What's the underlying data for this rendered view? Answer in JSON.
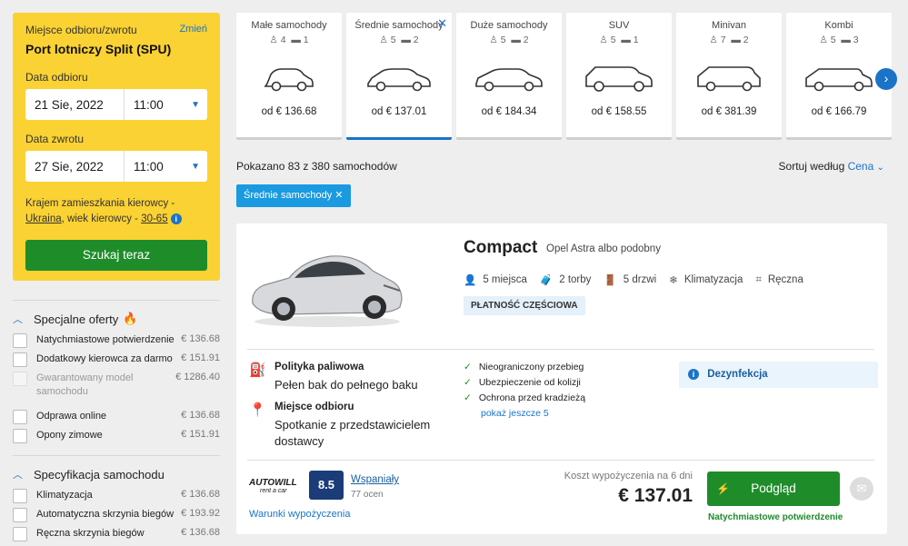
{
  "search": {
    "location_label": "Miejsce odbioru/zwrotu",
    "change_link": "Zmień",
    "location": "Port lotniczy Split (SPU)",
    "pickup_label": "Data odbioru",
    "pickup_date": "21  Sie, 2022",
    "pickup_time": "11:00",
    "return_label": "Data zwrotu",
    "return_date": "27  Sie, 2022",
    "return_time": "11:00",
    "residence_prefix": "Krajem zamieszkania kierowcy -",
    "residence_country": "Ukraina",
    "age_prefix": ", wiek kierowcy - ",
    "age_range": "30-65",
    "search_button": "Szukaj teraz"
  },
  "filters": {
    "special_title": "Specjalne oferty",
    "special_items": [
      {
        "label": "Natychmiastowe potwierdzenie",
        "price": "€ 136.68"
      },
      {
        "label": "Dodatkowy kierowca za darmo",
        "price": "€ 151.91"
      },
      {
        "label": "Gwarantowany model samochodu",
        "price": "€ 1286.40"
      },
      {
        "label": "Odprawa online",
        "price": "€ 136.68"
      },
      {
        "label": "Opony zimowe",
        "price": "€ 151.91"
      }
    ],
    "spec_title": "Specyfikacja samochodu",
    "spec_items": [
      {
        "label": "Klimatyzacja",
        "price": "€ 136.68"
      },
      {
        "label": "Automatyczna skrzynia biegów",
        "price": "€ 193.92"
      },
      {
        "label": "Ręczna skrzynia biegów",
        "price": "€ 136.68"
      }
    ]
  },
  "categories": [
    {
      "name": "Małe samochody",
      "seats": "4",
      "bags": "1",
      "price": "od € 136.68"
    },
    {
      "name": "Średnie samochody",
      "seats": "5",
      "bags": "2",
      "price": "od € 137.01"
    },
    {
      "name": "Duże samochody",
      "seats": "5",
      "bags": "2",
      "price": "od € 184.34"
    },
    {
      "name": "SUV",
      "seats": "5",
      "bags": "1",
      "price": "od € 158.55"
    },
    {
      "name": "Minivan",
      "seats": "7",
      "bags": "2",
      "price": "od € 381.39"
    },
    {
      "name": "Kombi",
      "seats": "5",
      "bags": "3",
      "price": "od € 166.79"
    }
  ],
  "results": {
    "count_text": "Pokazano 83 z 380 samochodów",
    "sort_label": "Sortuj według ",
    "sort_value": "Cena",
    "chip": "Średnie samochody"
  },
  "car": {
    "name": "Compact",
    "subtitle": "Opel Astra albo podobny",
    "seats": "5 miejsca",
    "bags": "2 torby",
    "doors": "5 drzwi",
    "ac": "Klimatyzacja",
    "gearbox": "Ręczna",
    "payment_badge": "PŁATNOŚĆ CZĘŚCIOWA",
    "fuel_title": "Polityka paliwowa",
    "fuel_value": "Pełen bak do pełnego baku",
    "pickup_title": "Miejsce odbioru",
    "pickup_value": "Spotkanie z przedstawicielem dostawcy",
    "perks": [
      "Nieograniczony przebieg",
      "Ubezpieczenie od kolizji",
      "Ochrona przed kradzieżą"
    ],
    "more_link": "pokaż jeszcze 5",
    "disinfection": "Dezynfekcja",
    "supplier_name": "AUTOWILL",
    "supplier_tag": "rent a car",
    "score": "8.5",
    "score_word": "Wspaniały",
    "score_count": "77 ocen",
    "terms_link": "Warunki wypożyczenia",
    "cost_label": "Koszt wypożyczenia na 6 dni",
    "cost": "€ 137.01",
    "view_button": "Podgląd",
    "instant_text": "Natychmiastowe potwierdzenie"
  }
}
